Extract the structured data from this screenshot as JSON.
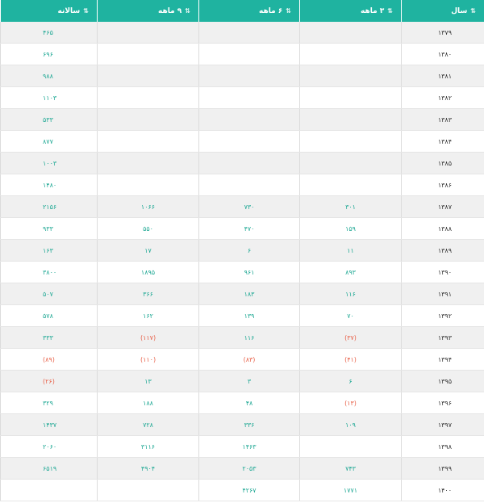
{
  "headers": [
    {
      "label": "سال",
      "sort_icon": "sort-icon"
    },
    {
      "label": "۳ ماهه",
      "sort_icon": "sort-icon"
    },
    {
      "label": "۶ ماهه",
      "sort_icon": "sort-icon"
    },
    {
      "label": "۹ ماهه",
      "sort_icon": "sort-icon"
    },
    {
      "label": "سالانه",
      "sort_icon": "sort-icon"
    }
  ],
  "rows": [
    {
      "year": "۱۳۷۹",
      "q3": "",
      "q6": "",
      "q9": "",
      "annual": "۴۶۵"
    },
    {
      "year": "۱۳۸۰",
      "q3": "",
      "q6": "",
      "q9": "",
      "annual": "۶۹۶"
    },
    {
      "year": "۱۳۸۱",
      "q3": "",
      "q6": "",
      "q9": "",
      "annual": "۹۸۸"
    },
    {
      "year": "۱۳۸۲",
      "q3": "",
      "q6": "",
      "q9": "",
      "annual": "۱۱۰۳"
    },
    {
      "year": "۱۳۸۳",
      "q3": "",
      "q6": "",
      "q9": "",
      "annual": "۵۳۳"
    },
    {
      "year": "۱۳۸۴",
      "q3": "",
      "q6": "",
      "q9": "",
      "annual": "۸۷۷"
    },
    {
      "year": "۱۳۸۵",
      "q3": "",
      "q6": "",
      "q9": "",
      "annual": "۱۰۰۳"
    },
    {
      "year": "۱۳۸۶",
      "q3": "",
      "q6": "",
      "q9": "",
      "annual": "۱۴۸۰"
    },
    {
      "year": "۱۳۸۷",
      "q3": "۳۰۱",
      "q6": "۷۳۰",
      "q9": "۱۰۶۶",
      "annual": "۲۱۵۶"
    },
    {
      "year": "۱۳۸۸",
      "q3": "۱۵۹",
      "q6": "۴۷۰",
      "q9": "۵۵۰",
      "annual": "۹۳۳"
    },
    {
      "year": "۱۳۸۹",
      "q3": "۱۱",
      "q6": "۶",
      "q9": "۱۷",
      "annual": "۱۶۳"
    },
    {
      "year": "۱۳۹۰",
      "q3": "۸۹۳",
      "q6": "۹۶۱",
      "q9": "۱۸۹۵",
      "annual": "۳۸۰۰"
    },
    {
      "year": "۱۳۹۱",
      "q3": "۱۱۶",
      "q6": "۱۸۳",
      "q9": "۳۶۶",
      "annual": "۵۰۷"
    },
    {
      "year": "۱۳۹۲",
      "q3": "۷۰",
      "q6": "۱۳۹",
      "q9": "۱۶۲",
      "annual": "۵۷۸"
    },
    {
      "year": "۱۳۹۳",
      "q3": "(۳۷)",
      "q6": "۱۱۶",
      "q9": "(۱۱۷)",
      "annual": "۳۳۳"
    },
    {
      "year": "۱۳۹۴",
      "q3": "(۴۱)",
      "q6": "(۸۳)",
      "q9": "(۱۱۰)",
      "annual": "(۸۹)"
    },
    {
      "year": "۱۳۹۵",
      "q3": "۶",
      "q6": "۳",
      "q9": "۱۳",
      "annual": "(۲۶)"
    },
    {
      "year": "۱۳۹۶",
      "q3": "(۱۳)",
      "q6": "۴۸",
      "q9": "۱۸۸",
      "annual": "۳۲۹"
    },
    {
      "year": "۱۳۹۷",
      "q3": "۱۰۹",
      "q6": "۳۳۶",
      "q9": "۷۲۸",
      "annual": "۱۴۳۷"
    },
    {
      "year": "۱۳۹۸",
      "q3": "",
      "q6": "۱۴۶۳",
      "q9": "۳۱۱۶",
      "annual": "۲۰۶۰"
    },
    {
      "year": "۱۳۹۹",
      "q3": "۷۴۳",
      "q6": "۲۰۵۳",
      "q9": "۴۹۰۴",
      "annual": "۶۵۱۹"
    },
    {
      "year": "۱۴۰۰",
      "q3": "۱۷۷۱",
      "q6": "۴۲۶۷",
      "q9": "",
      "annual": ""
    }
  ],
  "colors": {
    "header_bg": "#1fb3a0",
    "positive": "#1fa894",
    "negative": "#e8624a"
  }
}
